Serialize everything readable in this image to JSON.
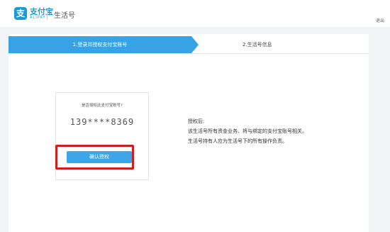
{
  "header": {
    "logo_mark": "支",
    "logo_cn": "支付宝",
    "logo_en": "ALIPAY",
    "app_title": "生活号",
    "logout": "退出"
  },
  "steps": [
    {
      "label": "1.登录并授权支付宝账号",
      "active": true
    },
    {
      "label": "2.生活号信息",
      "active": false
    }
  ],
  "auth": {
    "question": "是否授权此支付宝账号?",
    "account": "139****8369",
    "confirm_label": "确认授权"
  },
  "info": {
    "lines": [
      "授权后:",
      "该生活号所有资金业务、将与绑定的支付宝账号相关。",
      "生活号持有人应为生活号下的所有操作负责。"
    ]
  },
  "colors": {
    "accent": "#36a3e6",
    "button": "#3ba6ea",
    "highlight": "#cc1f1f",
    "background": "#f2f3f5"
  }
}
